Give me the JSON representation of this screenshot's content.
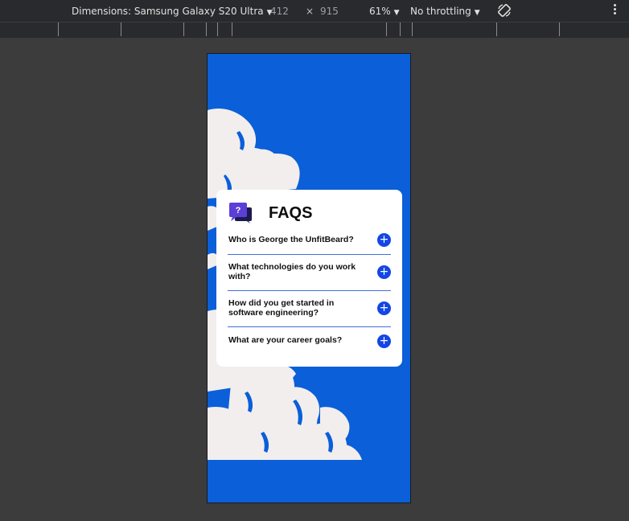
{
  "toolbar": {
    "device_label": "Dimensions: Samsung Galaxy S20 Ultra",
    "width": "412",
    "times": "×",
    "height": "915",
    "zoom": "61%",
    "throttling": "No throttling",
    "caret": "▼",
    "rotate_icon": "rotate-icon",
    "more_icon": "more-vert-icon"
  },
  "faq": {
    "title": "FAQS",
    "icon": "question-chat-icon",
    "plus_symbol": "+",
    "questions": [
      {
        "text": "Who is George the UnfitBeard?"
      },
      {
        "text": "What technologies do you work with?"
      },
      {
        "text": "How did you get started in software engineering?"
      },
      {
        "text": "What are your career goals?"
      }
    ]
  },
  "colors": {
    "background_blue": "#0b5fd8",
    "button_blue": "#1446e6",
    "divider_blue": "#3f6fe0",
    "card_white": "#ffffff"
  }
}
